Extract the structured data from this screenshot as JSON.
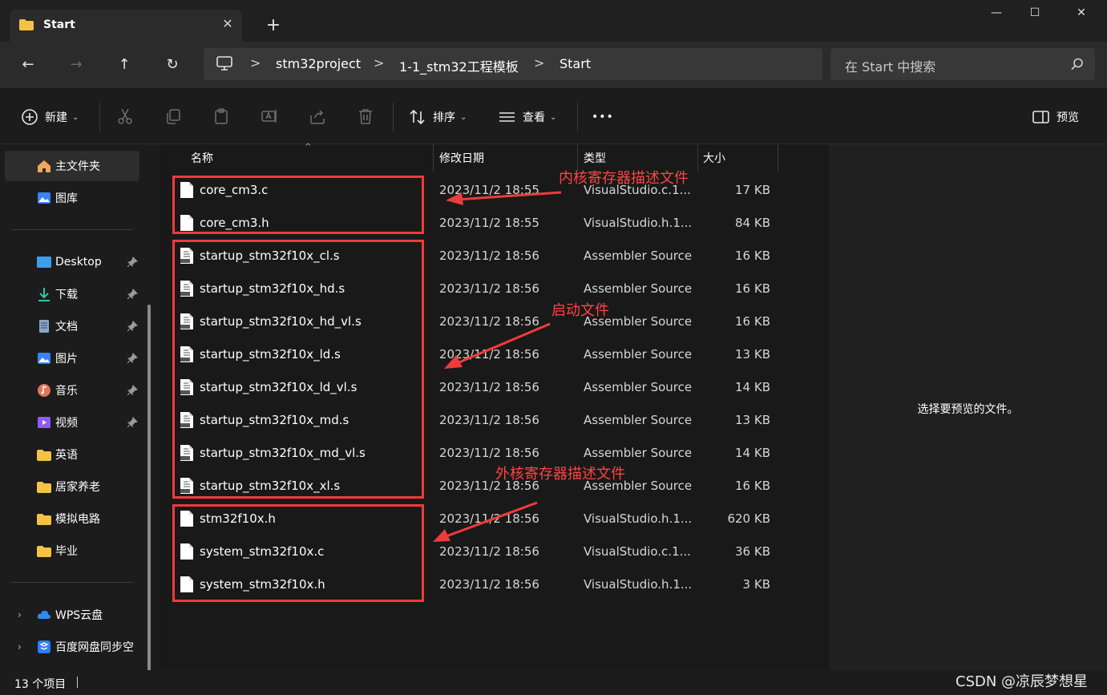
{
  "window": {
    "tab_title": "Start",
    "new_tab_glyph": "+",
    "close_tab_glyph": "✕",
    "minimize_glyph": "—",
    "maximize_glyph": "☐",
    "close_glyph": "✕"
  },
  "nav": {
    "back_glyph": "←",
    "forward_glyph": "→",
    "up_glyph": "↑",
    "refresh_glyph": "↻"
  },
  "breadcrumb": [
    "stm32project",
    "1-1_stm32工程模板",
    "Start"
  ],
  "breadcrumb_sep": ">",
  "search": {
    "placeholder": "在 Start 中搜索"
  },
  "toolbar": {
    "new_label": "新建",
    "sort_label": "排序",
    "view_label": "查看",
    "more_label": "•••",
    "preview_label": "预览",
    "chevron": "⌄"
  },
  "sidebar": {
    "home_label": "主文件夹",
    "gallery_label": "图库",
    "pinned": [
      {
        "label": "Desktop",
        "icon": "desktop-icon"
      },
      {
        "label": "下载",
        "icon": "download-icon"
      },
      {
        "label": "文档",
        "icon": "document-icon"
      },
      {
        "label": "图片",
        "icon": "pictures-icon"
      },
      {
        "label": "音乐",
        "icon": "music-icon"
      },
      {
        "label": "视频",
        "icon": "video-icon"
      }
    ],
    "folders": [
      "英语",
      "居家养老",
      "模拟电路",
      "毕业"
    ],
    "cloud": [
      {
        "label": "WPS云盘",
        "icon": "cloud-icon"
      },
      {
        "label": "百度网盘同步空",
        "icon": "baidu-icon"
      }
    ],
    "expander_glyph": "›"
  },
  "columns": {
    "name": "名称",
    "date": "修改日期",
    "type": "类型",
    "size": "大小",
    "sort_glyph": "^"
  },
  "files": [
    {
      "name": "core_cm3.c",
      "date": "2023/11/2 18:55",
      "type": "VisualStudio.c.1...",
      "size": "17 KB",
      "kind": "code"
    },
    {
      "name": "core_cm3.h",
      "date": "2023/11/2 18:55",
      "type": "VisualStudio.h.1...",
      "size": "84 KB",
      "kind": "code"
    },
    {
      "name": "startup_stm32f10x_cl.s",
      "date": "2023/11/2 18:56",
      "type": "Assembler Source",
      "size": "16 KB",
      "kind": "asm"
    },
    {
      "name": "startup_stm32f10x_hd.s",
      "date": "2023/11/2 18:56",
      "type": "Assembler Source",
      "size": "16 KB",
      "kind": "asm"
    },
    {
      "name": "startup_stm32f10x_hd_vl.s",
      "date": "2023/11/2 18:56",
      "type": "Assembler Source",
      "size": "16 KB",
      "kind": "asm"
    },
    {
      "name": "startup_stm32f10x_ld.s",
      "date": "2023/11/2 18:56",
      "type": "Assembler Source",
      "size": "13 KB",
      "kind": "asm"
    },
    {
      "name": "startup_stm32f10x_ld_vl.s",
      "date": "2023/11/2 18:56",
      "type": "Assembler Source",
      "size": "14 KB",
      "kind": "asm"
    },
    {
      "name": "startup_stm32f10x_md.s",
      "date": "2023/11/2 18:56",
      "type": "Assembler Source",
      "size": "13 KB",
      "kind": "asm"
    },
    {
      "name": "startup_stm32f10x_md_vl.s",
      "date": "2023/11/2 18:56",
      "type": "Assembler Source",
      "size": "14 KB",
      "kind": "asm"
    },
    {
      "name": "startup_stm32f10x_xl.s",
      "date": "2023/11/2 18:56",
      "type": "Assembler Source",
      "size": "16 KB",
      "kind": "asm"
    },
    {
      "name": "stm32f10x.h",
      "date": "2023/11/2 18:56",
      "type": "VisualStudio.h.1...",
      "size": "620 KB",
      "kind": "code"
    },
    {
      "name": "system_stm32f10x.c",
      "date": "2023/11/2 18:56",
      "type": "VisualStudio.c.1...",
      "size": "36 KB",
      "kind": "code"
    },
    {
      "name": "system_stm32f10x.h",
      "date": "2023/11/2 18:56",
      "type": "VisualStudio.h.1...",
      "size": "3 KB",
      "kind": "code"
    }
  ],
  "annotations": {
    "core": "内核寄存器描述文件",
    "startup": "启动文件",
    "peripheral": "外核寄存器描述文件",
    "color": "#ee3b3b"
  },
  "preview": {
    "message": "选择要预览的文件。"
  },
  "status": {
    "count": "13 个项目"
  },
  "watermark": "CSDN @凉辰梦想星"
}
